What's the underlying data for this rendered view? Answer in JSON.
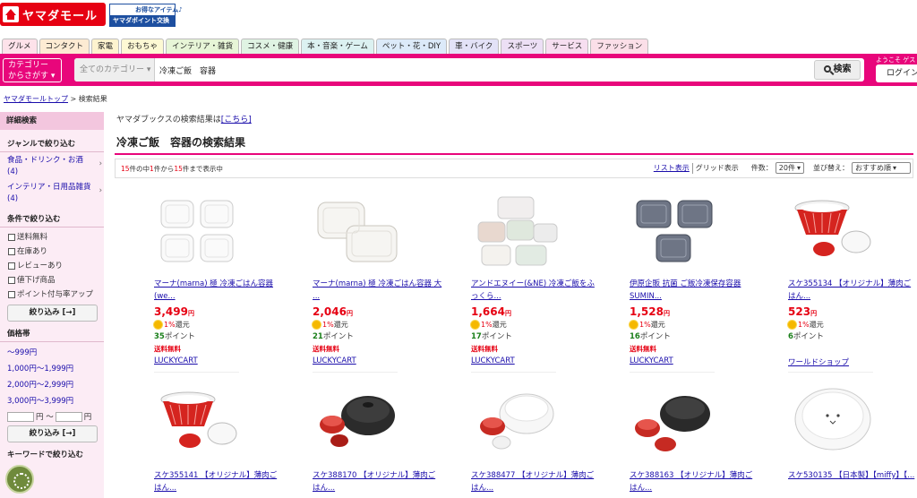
{
  "header": {
    "logo_text": "ヤマダモール",
    "point_banner_top": "お得なアイテム♪",
    "point_banner_bottom": "ヤマダポイント交換"
  },
  "tabs": [
    {
      "label": "グルメ",
      "color": "#fde2ea"
    },
    {
      "label": "コンタクト",
      "color": "#fdebd3"
    },
    {
      "label": "家電",
      "color": "#fdf3cf"
    },
    {
      "label": "おもちゃ",
      "color": "#fdf9d4"
    },
    {
      "label": "インテリア・雑貨",
      "color": "#e7f5d7"
    },
    {
      "label": "コスメ・健康",
      "color": "#dff3e3"
    },
    {
      "label": "本・音楽・ゲーム",
      "color": "#dcf1f1"
    },
    {
      "label": "ペット・花・DIY",
      "color": "#dceaf9"
    },
    {
      "label": "車・バイク",
      "color": "#e3e2f7"
    },
    {
      "label": "スポーツ",
      "color": "#ecdff5"
    },
    {
      "label": "サービス",
      "color": "#f6def0"
    },
    {
      "label": "ファッション",
      "color": "#fbdfe8"
    }
  ],
  "search": {
    "category_button": "カテゴリー\nからさがす",
    "category_select": "全てのカテゴリー",
    "query": "冷凍ご飯　容器",
    "button_label": "検索",
    "welcome": "ようこそ ゲスト",
    "login_label": "ログイン"
  },
  "breadcrumb": {
    "home": "ヤマダモールトップ",
    "current": "検索結果"
  },
  "sidebar": {
    "detail_search": "詳細検索",
    "genre_title": "ジャンルで絞り込む",
    "genres": [
      {
        "label": "食品・ドリンク・お酒(4)"
      },
      {
        "label": "インテリア・日用品雑貨(4)"
      }
    ],
    "condition_title": "条件で絞り込む",
    "conditions": [
      "送料無料",
      "在庫あり",
      "レビューあり",
      "値下げ商品",
      "ポイント付与率アップ"
    ],
    "narrow_button": "絞り込み [→]",
    "price_title": "価格帯",
    "prices": [
      "～999円",
      "1,000円～1,999円",
      "2,000円～2,999円",
      "3,000円～3,999円"
    ],
    "price_unit_from": "円 ～",
    "price_unit_to": "円",
    "narrow_button2": "絞り込み [→]",
    "keyword_title": "キーワードで絞り込む"
  },
  "main": {
    "yb_note_prefix": "ヤマダブックスの検索結果は",
    "yb_note_link": "[こちら]",
    "result_title": "冷凍ご飯　容器の検索結果",
    "count_total": "15",
    "count_text_1": "件の中",
    "count_from": "1",
    "count_text_2": "件から",
    "count_to": "15",
    "count_text_3": "件まで表示中",
    "list_view": "リスト表示",
    "grid_view": "グリッド表示",
    "per_page_label": "件数：",
    "per_page_value": "20件",
    "sort_label": "並び替え：",
    "sort_value": "おすすめ順"
  },
  "products": [
    {
      "name": "マーナ(marna) 極 冷凍ごはん容器 (we...",
      "price": "3,499",
      "rate": "1%",
      "points": "35",
      "free": "送料無料",
      "shop": "LUCKYCART"
    },
    {
      "name": "マーナ(marna) 極 冷凍ごはん容器 大 ...",
      "price": "2,046",
      "rate": "1%",
      "points": "21",
      "free": "送料無料",
      "shop": "LUCKYCART"
    },
    {
      "name": "アンドエヌイー(&NE) 冷凍ご飯をふっくら...",
      "price": "1,664",
      "rate": "1%",
      "points": "17",
      "free": "送料無料",
      "shop": "LUCKYCART"
    },
    {
      "name": "伊原企販 抗菌 ご飯冷凍保存容器 SUMIN...",
      "price": "1,528",
      "rate": "1%",
      "points": "16",
      "free": "送料無料",
      "shop": "LUCKYCART"
    },
    {
      "name": "スケ355134 【オリジナル】薄肉ごはん...",
      "price": "523",
      "rate": "1%",
      "points": "6",
      "free": "",
      "shop": "ワールドショップ"
    },
    {
      "name": "スケ355141 【オリジナル】薄肉ごはん..."
    },
    {
      "name": "スケ388170 【オリジナル】薄肉ごはん..."
    },
    {
      "name": "スケ388477 【オリジナル】薄肉ごはん..."
    },
    {
      "name": "スケ388163 【オリジナル】薄肉ごはん..."
    },
    {
      "name": "スケ530135 【日本製】【miffy】【..."
    }
  ],
  "labels": {
    "yen": "円",
    "rebate": "還元",
    "point": "ポイント"
  },
  "colors": {
    "brand_red": "#e60012",
    "search_bar": "#e8067b",
    "sidebar_bg": "#fcecf5"
  }
}
